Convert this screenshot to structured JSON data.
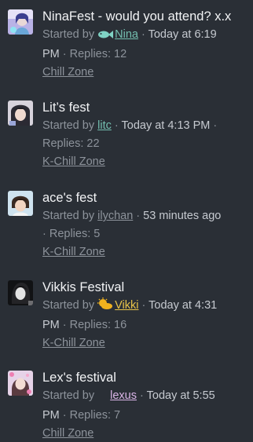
{
  "threads": [
    {
      "title": "NinaFest - would you attend? x.x",
      "started_by": "Started by",
      "author": "Nina",
      "author_icon": "fish-icon",
      "dot1": "·",
      "time_a": "Today at 6:19",
      "time_b": "PM",
      "replies": "· Replies: 12",
      "forum": "Chill Zone"
    },
    {
      "title": "Lit’s fest",
      "started_by": "Started by",
      "author": "litc",
      "dot1": "·",
      "time_a": "Today at 4:13 PM",
      "dot2": "·",
      "replies": "Replies: 22",
      "forum": "K-Chill Zone"
    },
    {
      "title": "ace's fest",
      "started_by": "Started by",
      "author": "ilychan",
      "dot1": "·",
      "time_a": "53 minutes ago",
      "replies": "· Replies: 5",
      "forum": "K-Chill Zone"
    },
    {
      "title": "Vikkis Festival",
      "started_by": "Started by",
      "author": "Vikki",
      "author_icon": "sun-cloud-icon",
      "dot1": "·",
      "time_a": "Today at 4:31",
      "time_b": "PM",
      "replies": "· Replies: 16",
      "forum": "K-Chill Zone"
    },
    {
      "title": "Lex's festival",
      "started_by": "Started by",
      "author": "lexus",
      "author_icon": "crescent-moon-icon",
      "dot1": "·",
      "time_a": "Today at 5:55",
      "time_b": "PM",
      "replies": "· Replies: 7",
      "forum": "Chill Zone"
    }
  ],
  "colors": {
    "background": "#2a2f36",
    "title": "#f2f3f5",
    "meta": "#8d939b",
    "username_teal": "#86c2b3",
    "username_gold": "#e8c349"
  }
}
